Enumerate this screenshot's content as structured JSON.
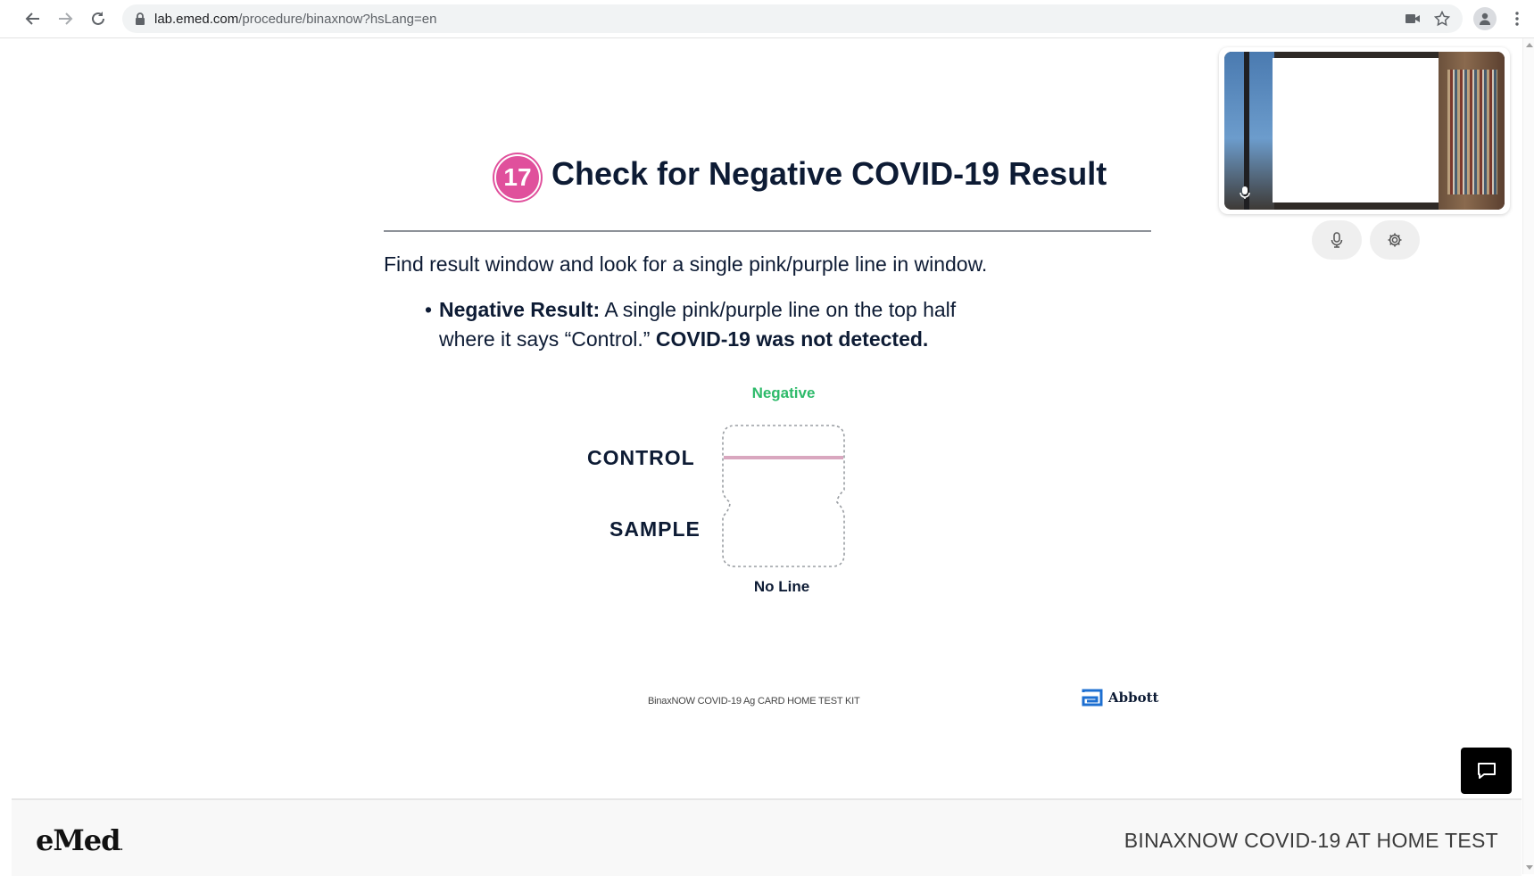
{
  "browser": {
    "url_host": "lab.emed.com",
    "url_path": "/procedure/binaxnow?hsLang=en",
    "back_icon": "arrow-left-icon",
    "forward_icon": "arrow-right-icon",
    "reload_icon": "reload-icon"
  },
  "slide": {
    "step_number": "17",
    "title": "Check for Negative COVID-19 Result",
    "instruction": "Find result window and look for a single pink/purple line in window.",
    "bullet": {
      "lead": "Negative Result:",
      "text1": " A single pink/purple line on the top half",
      "text2": "where it says “Control.” ",
      "emphasis": "COVID-19 was not detected."
    },
    "result_label": "Negative",
    "control_label": "CONTROL",
    "sample_label": "SAMPLE",
    "no_line_label": "No Line",
    "kit_name": "BinaxNOW COVID-19 Ag CARD HOME TEST KIT",
    "manufacturer": "Abbott",
    "colors": {
      "accent_pink": "#e0509c",
      "negative_green": "#2dba6a",
      "navy": "#0d1b34",
      "control_line": "#d9a7bf"
    }
  },
  "video_controls": {
    "mic_icon": "microphone-icon",
    "settings_icon": "gear-icon"
  },
  "footer": {
    "brand": "eMed",
    "product_title": "BINAXNOW COVID-19 AT HOME TEST"
  }
}
